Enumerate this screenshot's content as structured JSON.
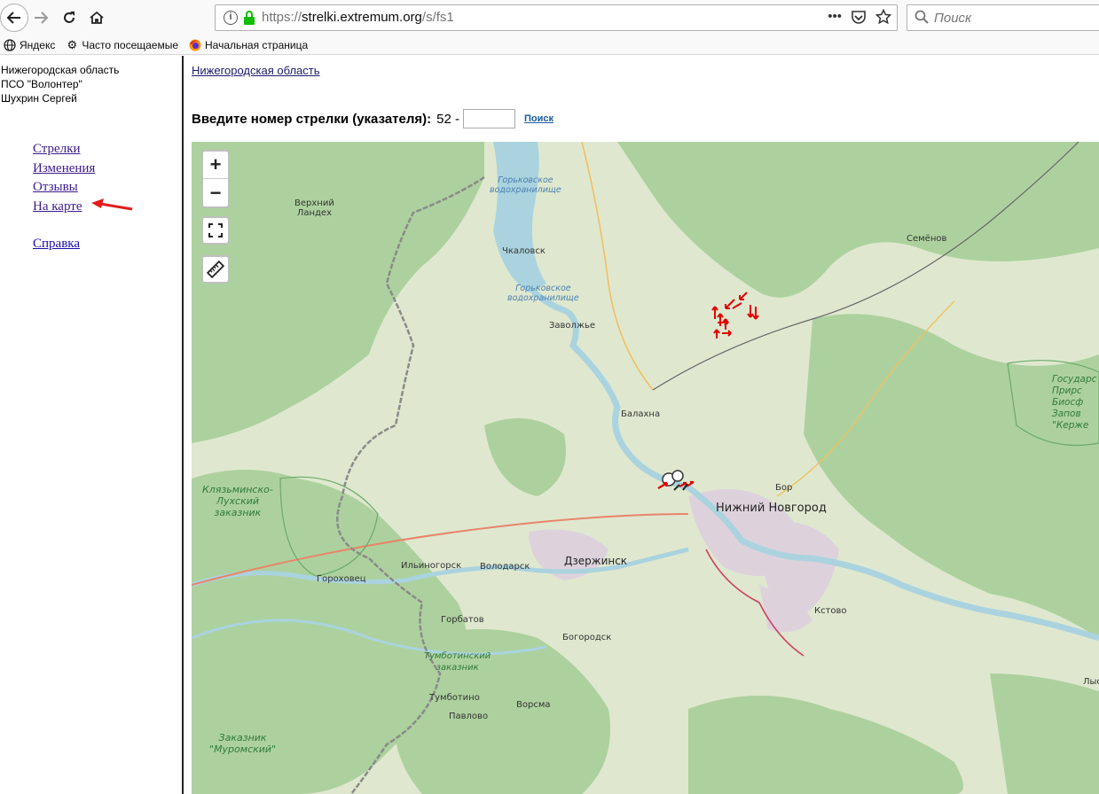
{
  "browser": {
    "url_scheme": "https://",
    "url_host": "strelki.extremum.org",
    "url_path": "/s/fs1",
    "url_menu": "•••",
    "search_placeholder": "Поиск",
    "bookmarks": [
      {
        "label": "Яндекс",
        "icon": "globe-icon"
      },
      {
        "label": "Часто посещаемые",
        "icon": "gear-icon"
      },
      {
        "label": "Начальная страница",
        "icon": "firefox-icon"
      }
    ]
  },
  "sidebar": {
    "region": "Нижегородская область",
    "org": "ПСО \"Волонтер\"",
    "person": "Шухрин Сергей",
    "menu": {
      "arrows": "Стрелки",
      "changes": "Изменения",
      "reviews": "Отзывы",
      "on_map": "На карте",
      "help": "Справка"
    }
  },
  "main": {
    "region_link": "Нижегородская область",
    "prompt_label": "Введите номер стрелки (указателя):",
    "prompt_prefix": "52 -",
    "search_link": "Поиск"
  },
  "map": {
    "controls": {
      "zoom_in": "+",
      "zoom_out": "−"
    },
    "labels": {
      "verkhny_landekh": "Верхний\nЛандех",
      "gorky_res_1": "Горьковское\nводохранилище",
      "gorky_res_2": "Горьковское\nводохранилище",
      "chkalovsk": "Чкаловск",
      "zavolzhye": "Заволжье",
      "semenov": "Семёнов",
      "balakhna": "Балахна",
      "bor": "Бор",
      "nizhny": "Нижний Новгород",
      "dzerzhinsk": "Дзержинск",
      "ilyinogorsk": "Ильиногорск",
      "volodarsk": "Володарск",
      "gorokhovets": "Гороховец",
      "gorbatov": "Горбатов",
      "bogorodsk": "Богородск",
      "kstovo": "Кстово",
      "tumbotino": "Тумботино",
      "pavlovo": "Павлово",
      "vorsma": "Ворсма",
      "klyazma": "Клязьминско-\nЛухский\nзаказник",
      "tumbotinsky": "Тумботинский\nзаказник",
      "muromsky": "Заказник\n\"Муромский\"",
      "kerzhensky": "Государс\nПрирс\nБиосф\nЗапов\n\"Керже",
      "lys": "Лыс"
    },
    "colors": {
      "forest": "#add19e",
      "field": "#dfe8cf",
      "water": "#aad3df",
      "urban": "#ddd2dc",
      "marker": "#e00000"
    }
  }
}
